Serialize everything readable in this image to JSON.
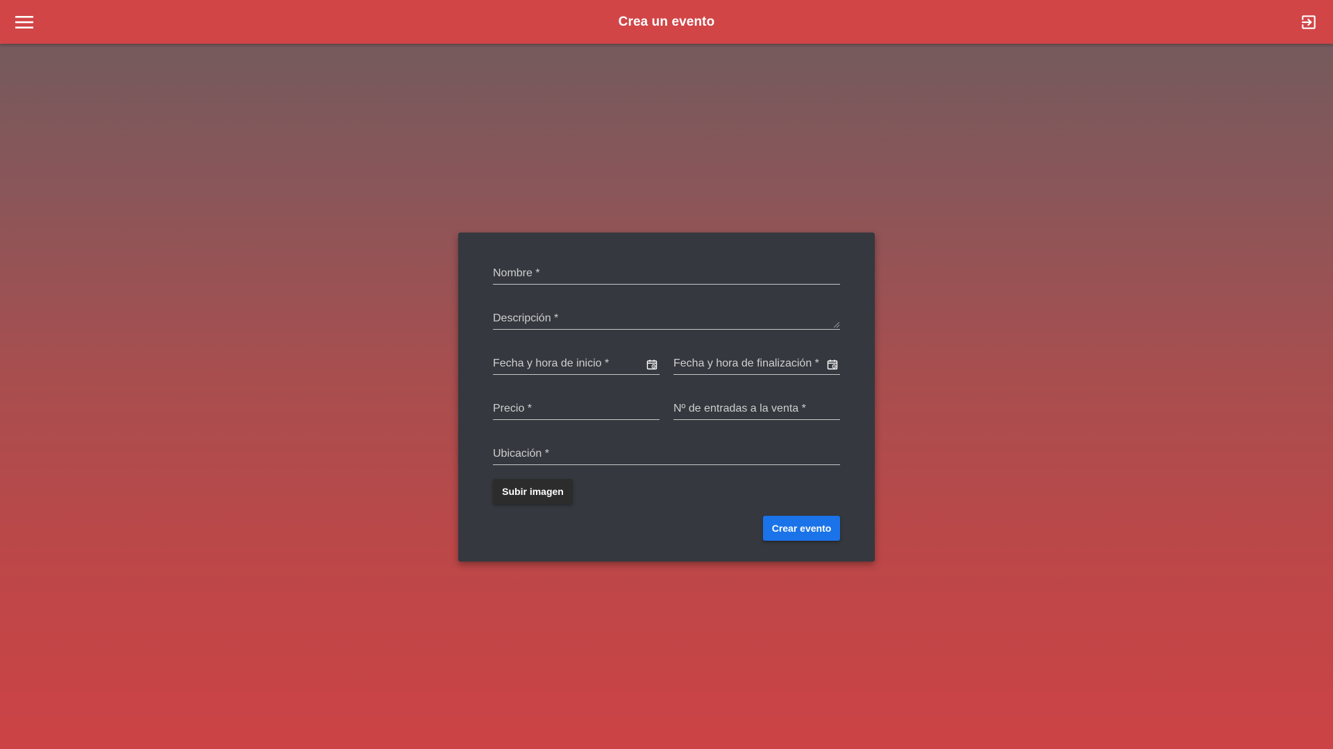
{
  "header": {
    "title": "Crea un evento",
    "menu_icon": "menu-icon",
    "logout_icon": "logout-icon",
    "background": "#d14547"
  },
  "form": {
    "nombre_label": "Nombre *",
    "descripcion_label": "Descripción *",
    "fecha_inicio_label": "Fecha y hora de inicio *",
    "fecha_fin_label": "Fecha y hora de finalización *",
    "precio_label": "Precio *",
    "entradas_label": "Nº de entradas a la venta *",
    "ubicacion_label": "Ubicación *",
    "calendar_icon": "calendar-icon",
    "upload_label": "Subir imagen",
    "submit_label": "Crear evento",
    "card_color": "#35383e",
    "accent": "#1a73e8"
  }
}
